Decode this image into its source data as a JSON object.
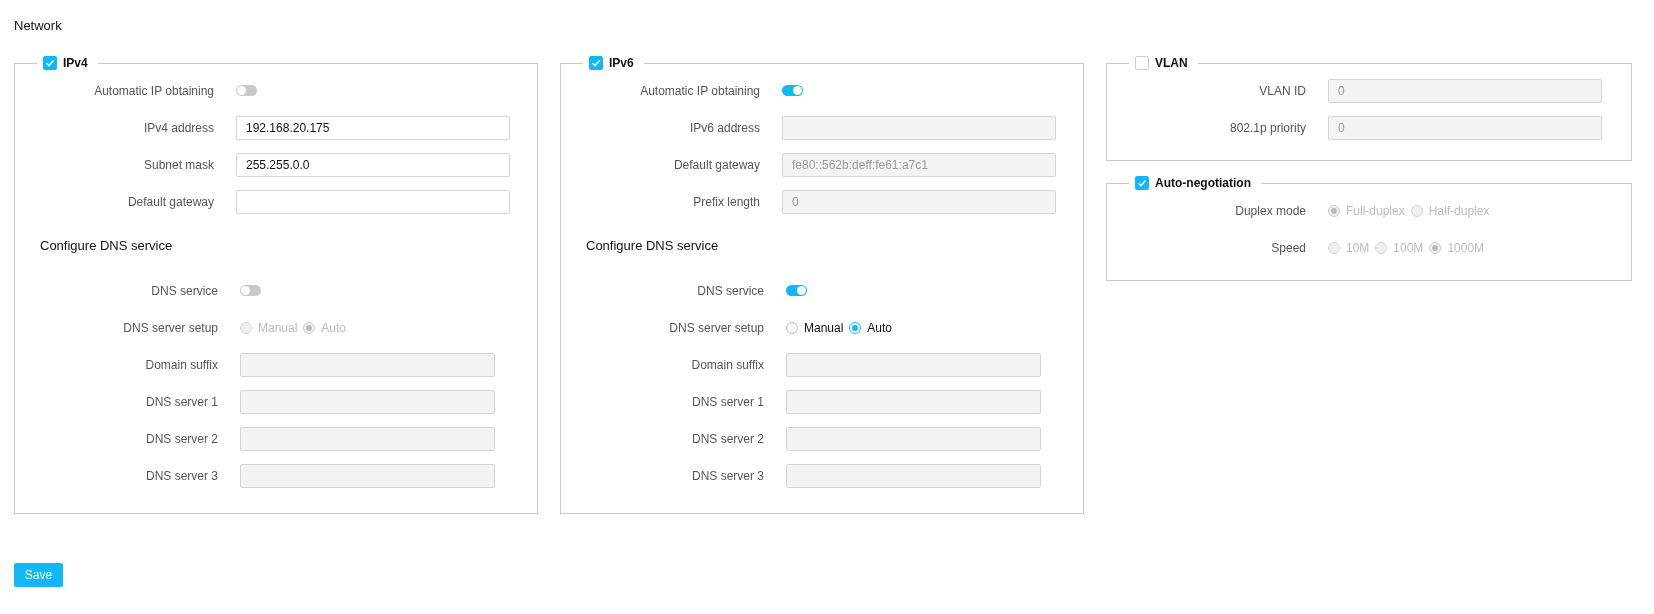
{
  "title": "Network",
  "columns": [
    [
      {
        "title": "IPv4",
        "checked": true,
        "sections": [
          {
            "rows": [
              {
                "kind": "toggle",
                "label": "Automatic IP obtaining",
                "on": false
              },
              {
                "kind": "input",
                "label": "IPv4 address",
                "value": "192.168.20.175",
                "disabled": false
              },
              {
                "kind": "input",
                "label": "Subnet mask",
                "value": "255.255.0.0",
                "disabled": false
              },
              {
                "kind": "input",
                "label": "Default gateway",
                "disabled": false
              }
            ]
          },
          {
            "heading": "Configure DNS service",
            "rows": [
              {
                "kind": "toggle",
                "label": "DNS service",
                "on": false
              },
              {
                "kind": "radio",
                "label": "DNS server setup",
                "disabled": true,
                "options": [
                  {
                    "label": "Manual",
                    "selected": false
                  },
                  {
                    "label": "Auto",
                    "selected": true
                  }
                ]
              },
              {
                "kind": "input",
                "label": "Domain suffix",
                "disabled": true
              },
              {
                "kind": "input",
                "label": "DNS server 1",
                "disabled": true
              },
              {
                "kind": "input",
                "label": "DNS server 2",
                "disabled": true
              },
              {
                "kind": "input",
                "label": "DNS server 3",
                "disabled": true
              }
            ]
          }
        ]
      }
    ],
    [
      {
        "title": "IPv6",
        "checked": true,
        "sections": [
          {
            "rows": [
              {
                "kind": "toggle",
                "label": "Automatic IP obtaining",
                "on": true
              },
              {
                "kind": "input",
                "label": "IPv6 address",
                "disabled": true
              },
              {
                "kind": "input",
                "label": "Default gateway",
                "value": "fe80::562b:deff:fe61:a7c1",
                "disabled": true
              },
              {
                "kind": "input",
                "label": "Prefix length",
                "value": "0",
                "disabled": true
              }
            ]
          },
          {
            "heading": "Configure DNS service",
            "rows": [
              {
                "kind": "toggle",
                "label": "DNS service",
                "on": true
              },
              {
                "kind": "radio",
                "label": "DNS server setup",
                "disabled": false,
                "options": [
                  {
                    "label": "Manual",
                    "selected": false
                  },
                  {
                    "label": "Auto",
                    "selected": true
                  }
                ]
              },
              {
                "kind": "input",
                "label": "Domain suffix",
                "disabled": true
              },
              {
                "kind": "input",
                "label": "DNS server 1",
                "disabled": true
              },
              {
                "kind": "input",
                "label": "DNS server 2",
                "disabled": true
              },
              {
                "kind": "input",
                "label": "DNS server 3",
                "disabled": true
              }
            ]
          }
        ]
      }
    ],
    [
      {
        "title": "VLAN",
        "checked": false,
        "sections": [
          {
            "rows": [
              {
                "kind": "input",
                "label": "VLAN ID",
                "value": "0",
                "disabled": true
              },
              {
                "kind": "input",
                "label": "802.1p priority",
                "value": "0",
                "disabled": true
              }
            ]
          }
        ]
      },
      {
        "title": "Auto-negotiation",
        "checked": true,
        "sections": [
          {
            "rows": [
              {
                "kind": "radio",
                "label": "Duplex mode",
                "disabled": true,
                "options": [
                  {
                    "label": "Full-duplex",
                    "selected": true
                  },
                  {
                    "label": "Half-duplex",
                    "selected": false
                  }
                ]
              },
              {
                "kind": "radio",
                "label": "Speed",
                "disabled": true,
                "options": [
                  {
                    "label": "10M",
                    "selected": false
                  },
                  {
                    "label": "100M",
                    "selected": false
                  },
                  {
                    "label": "1000M",
                    "selected": true
                  }
                ]
              }
            ]
          }
        ]
      }
    ]
  ],
  "save_button": {
    "label": "Save"
  }
}
